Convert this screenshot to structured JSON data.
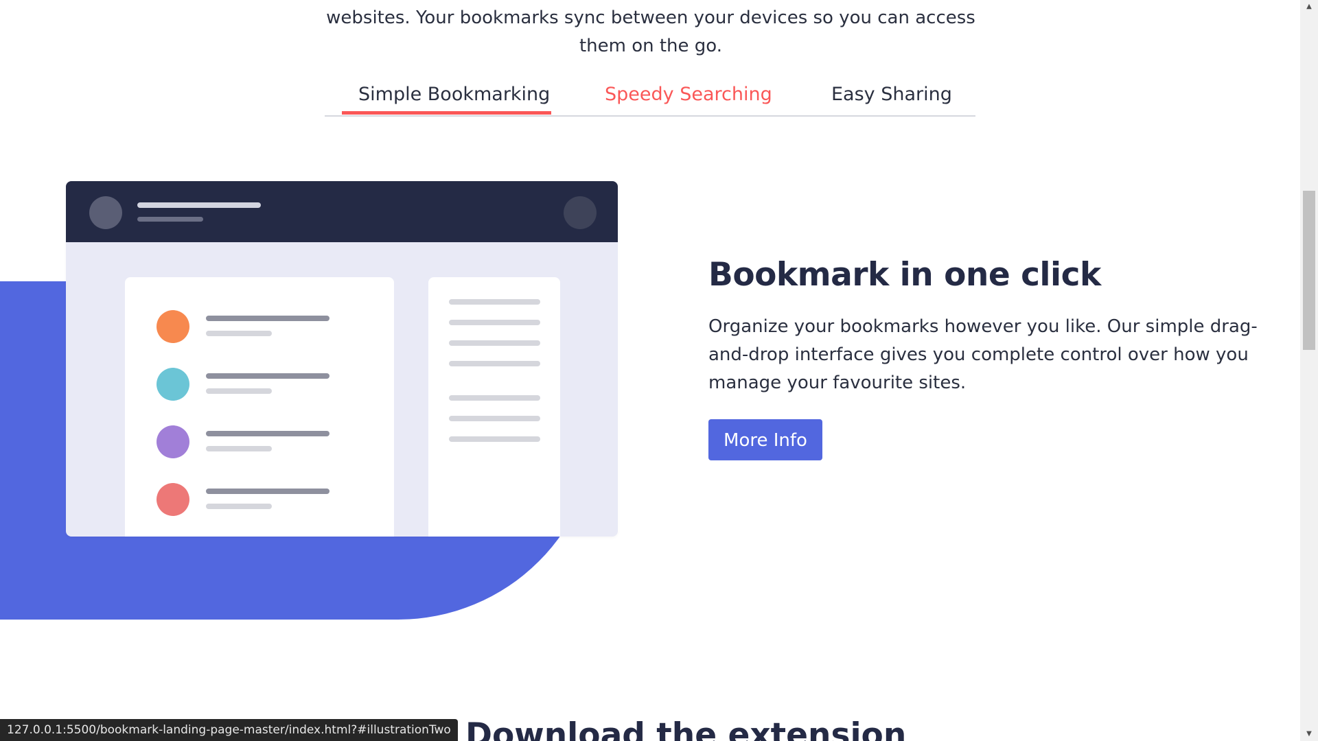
{
  "intro": {
    "line1": "websites. Your bookmarks sync between your devices so you can access",
    "line2": "them on the go."
  },
  "tabs": [
    {
      "label": "Simple Bookmarking",
      "state": "active"
    },
    {
      "label": "Speedy Searching",
      "state": "hover"
    },
    {
      "label": "Easy Sharing",
      "state": "default"
    }
  ],
  "feature": {
    "title": "Bookmark in one click",
    "desc_line1": "Organize your bookmarks however you like. Our simple drag-",
    "desc_line2": "and-drop interface gives you complete control over how you",
    "desc_line3": "manage your favourite sites.",
    "button_label": "More Info"
  },
  "illustration": {
    "dot_colors": [
      "#f7894f",
      "#6bc5d6",
      "#a17fd8",
      "#ed7877"
    ]
  },
  "next_section": {
    "heading": "Download the extension"
  },
  "status_bar": {
    "url": "127.0.0.1:5500/bookmark-landing-page-master/index.html?#illustrationTwo"
  },
  "colors": {
    "accent_red": "#fa5757",
    "brand_blue": "#5267df",
    "dark_navy": "#242a45"
  },
  "scrollbar": {
    "up_icon": "triangle-up-icon",
    "down_icon": "triangle-down-icon"
  }
}
